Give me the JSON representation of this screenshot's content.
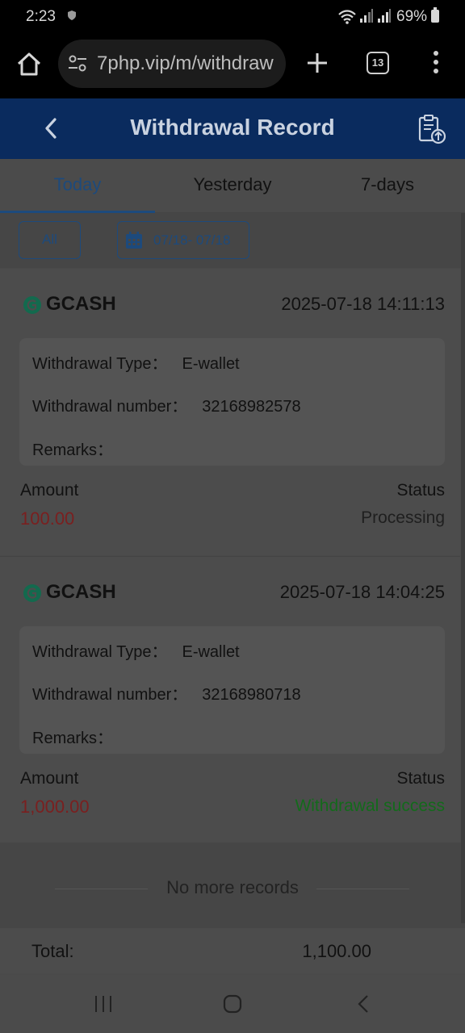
{
  "status_bar": {
    "time": "2:23",
    "battery_text": "69%"
  },
  "browser": {
    "url": "7php.vip/m/withdraw",
    "tab_count": "13"
  },
  "header": {
    "title": "Withdrawal Record"
  },
  "tabs": [
    {
      "label": "Today",
      "active": true
    },
    {
      "label": "Yesterday",
      "active": false
    },
    {
      "label": "7-days",
      "active": false
    }
  ],
  "filters": {
    "all_label": "All",
    "date_range": "07/18- 07/18"
  },
  "records": [
    {
      "method": "GCASH",
      "datetime": "2025-07-18 14:11:13",
      "type_label": "Withdrawal Type：",
      "type_value": "E-wallet",
      "number_label": "Withdrawal number：",
      "number_value": "32168982578",
      "remarks_label": "Remarks：",
      "amount_label": "Amount",
      "amount": "100.00",
      "status_label": "Status",
      "status": "Processing"
    },
    {
      "method": "GCASH",
      "datetime": "2025-07-18 14:04:25",
      "type_label": "Withdrawal Type：",
      "type_value": "E-wallet",
      "number_label": "Withdrawal number：",
      "number_value": "32168980718",
      "remarks_label": "Remarks：",
      "amount_label": "Amount",
      "amount": "1,000.00",
      "status_label": "Status",
      "status": "Withdrawal success"
    }
  ],
  "footer": {
    "no_more": "No more records",
    "total_label": "Total:",
    "total_value": "1,100.00"
  },
  "colors": {
    "header_bg": "#0a2b5e",
    "accent": "#1d4a7c",
    "amount_red": "#7a1f1f",
    "success_green": "#136a1b"
  },
  "icons": [
    "shield-icon",
    "wifi-icon",
    "signal-icon",
    "battery-icon",
    "home-icon",
    "site-settings-icon",
    "plus-icon",
    "tabs-icon",
    "more-vert-icon",
    "back-arrow-icon",
    "export-icon",
    "calendar-icon",
    "gcash-icon",
    "recents-icon",
    "nav-home-icon",
    "nav-back-icon"
  ]
}
